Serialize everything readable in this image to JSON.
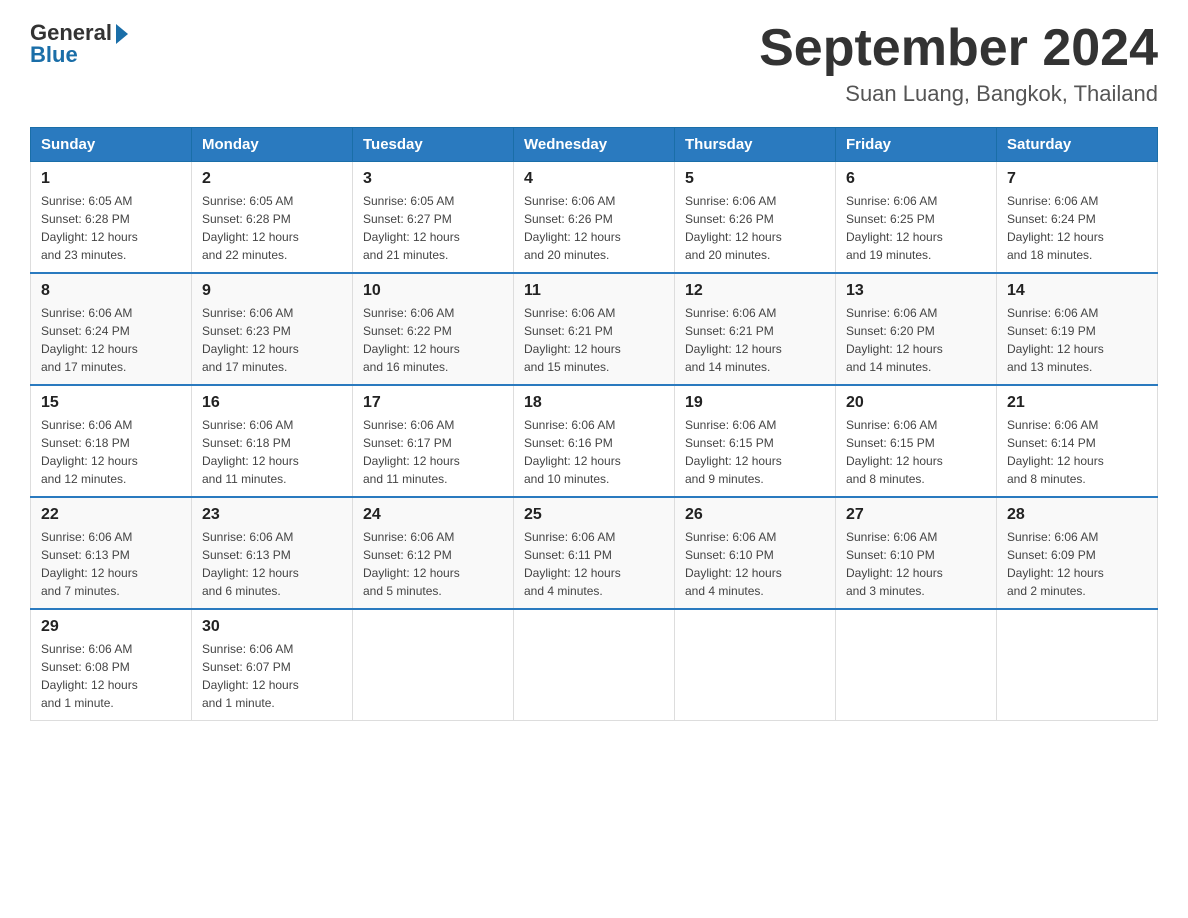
{
  "header": {
    "logo": {
      "general": "General",
      "blue": "Blue"
    },
    "title": "September 2024",
    "subtitle": "Suan Luang, Bangkok, Thailand"
  },
  "days_of_week": [
    "Sunday",
    "Monday",
    "Tuesday",
    "Wednesday",
    "Thursday",
    "Friday",
    "Saturday"
  ],
  "weeks": [
    [
      {
        "day": "1",
        "sunrise": "6:05 AM",
        "sunset": "6:28 PM",
        "daylight": "12 hours and 23 minutes."
      },
      {
        "day": "2",
        "sunrise": "6:05 AM",
        "sunset": "6:28 PM",
        "daylight": "12 hours and 22 minutes."
      },
      {
        "day": "3",
        "sunrise": "6:05 AM",
        "sunset": "6:27 PM",
        "daylight": "12 hours and 21 minutes."
      },
      {
        "day": "4",
        "sunrise": "6:06 AM",
        "sunset": "6:26 PM",
        "daylight": "12 hours and 20 minutes."
      },
      {
        "day": "5",
        "sunrise": "6:06 AM",
        "sunset": "6:26 PM",
        "daylight": "12 hours and 20 minutes."
      },
      {
        "day": "6",
        "sunrise": "6:06 AM",
        "sunset": "6:25 PM",
        "daylight": "12 hours and 19 minutes."
      },
      {
        "day": "7",
        "sunrise": "6:06 AM",
        "sunset": "6:24 PM",
        "daylight": "12 hours and 18 minutes."
      }
    ],
    [
      {
        "day": "8",
        "sunrise": "6:06 AM",
        "sunset": "6:24 PM",
        "daylight": "12 hours and 17 minutes."
      },
      {
        "day": "9",
        "sunrise": "6:06 AM",
        "sunset": "6:23 PM",
        "daylight": "12 hours and 17 minutes."
      },
      {
        "day": "10",
        "sunrise": "6:06 AM",
        "sunset": "6:22 PM",
        "daylight": "12 hours and 16 minutes."
      },
      {
        "day": "11",
        "sunrise": "6:06 AM",
        "sunset": "6:21 PM",
        "daylight": "12 hours and 15 minutes."
      },
      {
        "day": "12",
        "sunrise": "6:06 AM",
        "sunset": "6:21 PM",
        "daylight": "12 hours and 14 minutes."
      },
      {
        "day": "13",
        "sunrise": "6:06 AM",
        "sunset": "6:20 PM",
        "daylight": "12 hours and 14 minutes."
      },
      {
        "day": "14",
        "sunrise": "6:06 AM",
        "sunset": "6:19 PM",
        "daylight": "12 hours and 13 minutes."
      }
    ],
    [
      {
        "day": "15",
        "sunrise": "6:06 AM",
        "sunset": "6:18 PM",
        "daylight": "12 hours and 12 minutes."
      },
      {
        "day": "16",
        "sunrise": "6:06 AM",
        "sunset": "6:18 PM",
        "daylight": "12 hours and 11 minutes."
      },
      {
        "day": "17",
        "sunrise": "6:06 AM",
        "sunset": "6:17 PM",
        "daylight": "12 hours and 11 minutes."
      },
      {
        "day": "18",
        "sunrise": "6:06 AM",
        "sunset": "6:16 PM",
        "daylight": "12 hours and 10 minutes."
      },
      {
        "day": "19",
        "sunrise": "6:06 AM",
        "sunset": "6:15 PM",
        "daylight": "12 hours and 9 minutes."
      },
      {
        "day": "20",
        "sunrise": "6:06 AM",
        "sunset": "6:15 PM",
        "daylight": "12 hours and 8 minutes."
      },
      {
        "day": "21",
        "sunrise": "6:06 AM",
        "sunset": "6:14 PM",
        "daylight": "12 hours and 8 minutes."
      }
    ],
    [
      {
        "day": "22",
        "sunrise": "6:06 AM",
        "sunset": "6:13 PM",
        "daylight": "12 hours and 7 minutes."
      },
      {
        "day": "23",
        "sunrise": "6:06 AM",
        "sunset": "6:13 PM",
        "daylight": "12 hours and 6 minutes."
      },
      {
        "day": "24",
        "sunrise": "6:06 AM",
        "sunset": "6:12 PM",
        "daylight": "12 hours and 5 minutes."
      },
      {
        "day": "25",
        "sunrise": "6:06 AM",
        "sunset": "6:11 PM",
        "daylight": "12 hours and 4 minutes."
      },
      {
        "day": "26",
        "sunrise": "6:06 AM",
        "sunset": "6:10 PM",
        "daylight": "12 hours and 4 minutes."
      },
      {
        "day": "27",
        "sunrise": "6:06 AM",
        "sunset": "6:10 PM",
        "daylight": "12 hours and 3 minutes."
      },
      {
        "day": "28",
        "sunrise": "6:06 AM",
        "sunset": "6:09 PM",
        "daylight": "12 hours and 2 minutes."
      }
    ],
    [
      {
        "day": "29",
        "sunrise": "6:06 AM",
        "sunset": "6:08 PM",
        "daylight": "12 hours and 1 minute."
      },
      {
        "day": "30",
        "sunrise": "6:06 AM",
        "sunset": "6:07 PM",
        "daylight": "12 hours and 1 minute."
      },
      null,
      null,
      null,
      null,
      null
    ]
  ],
  "labels": {
    "sunrise": "Sunrise:",
    "sunset": "Sunset:",
    "daylight": "Daylight:"
  }
}
